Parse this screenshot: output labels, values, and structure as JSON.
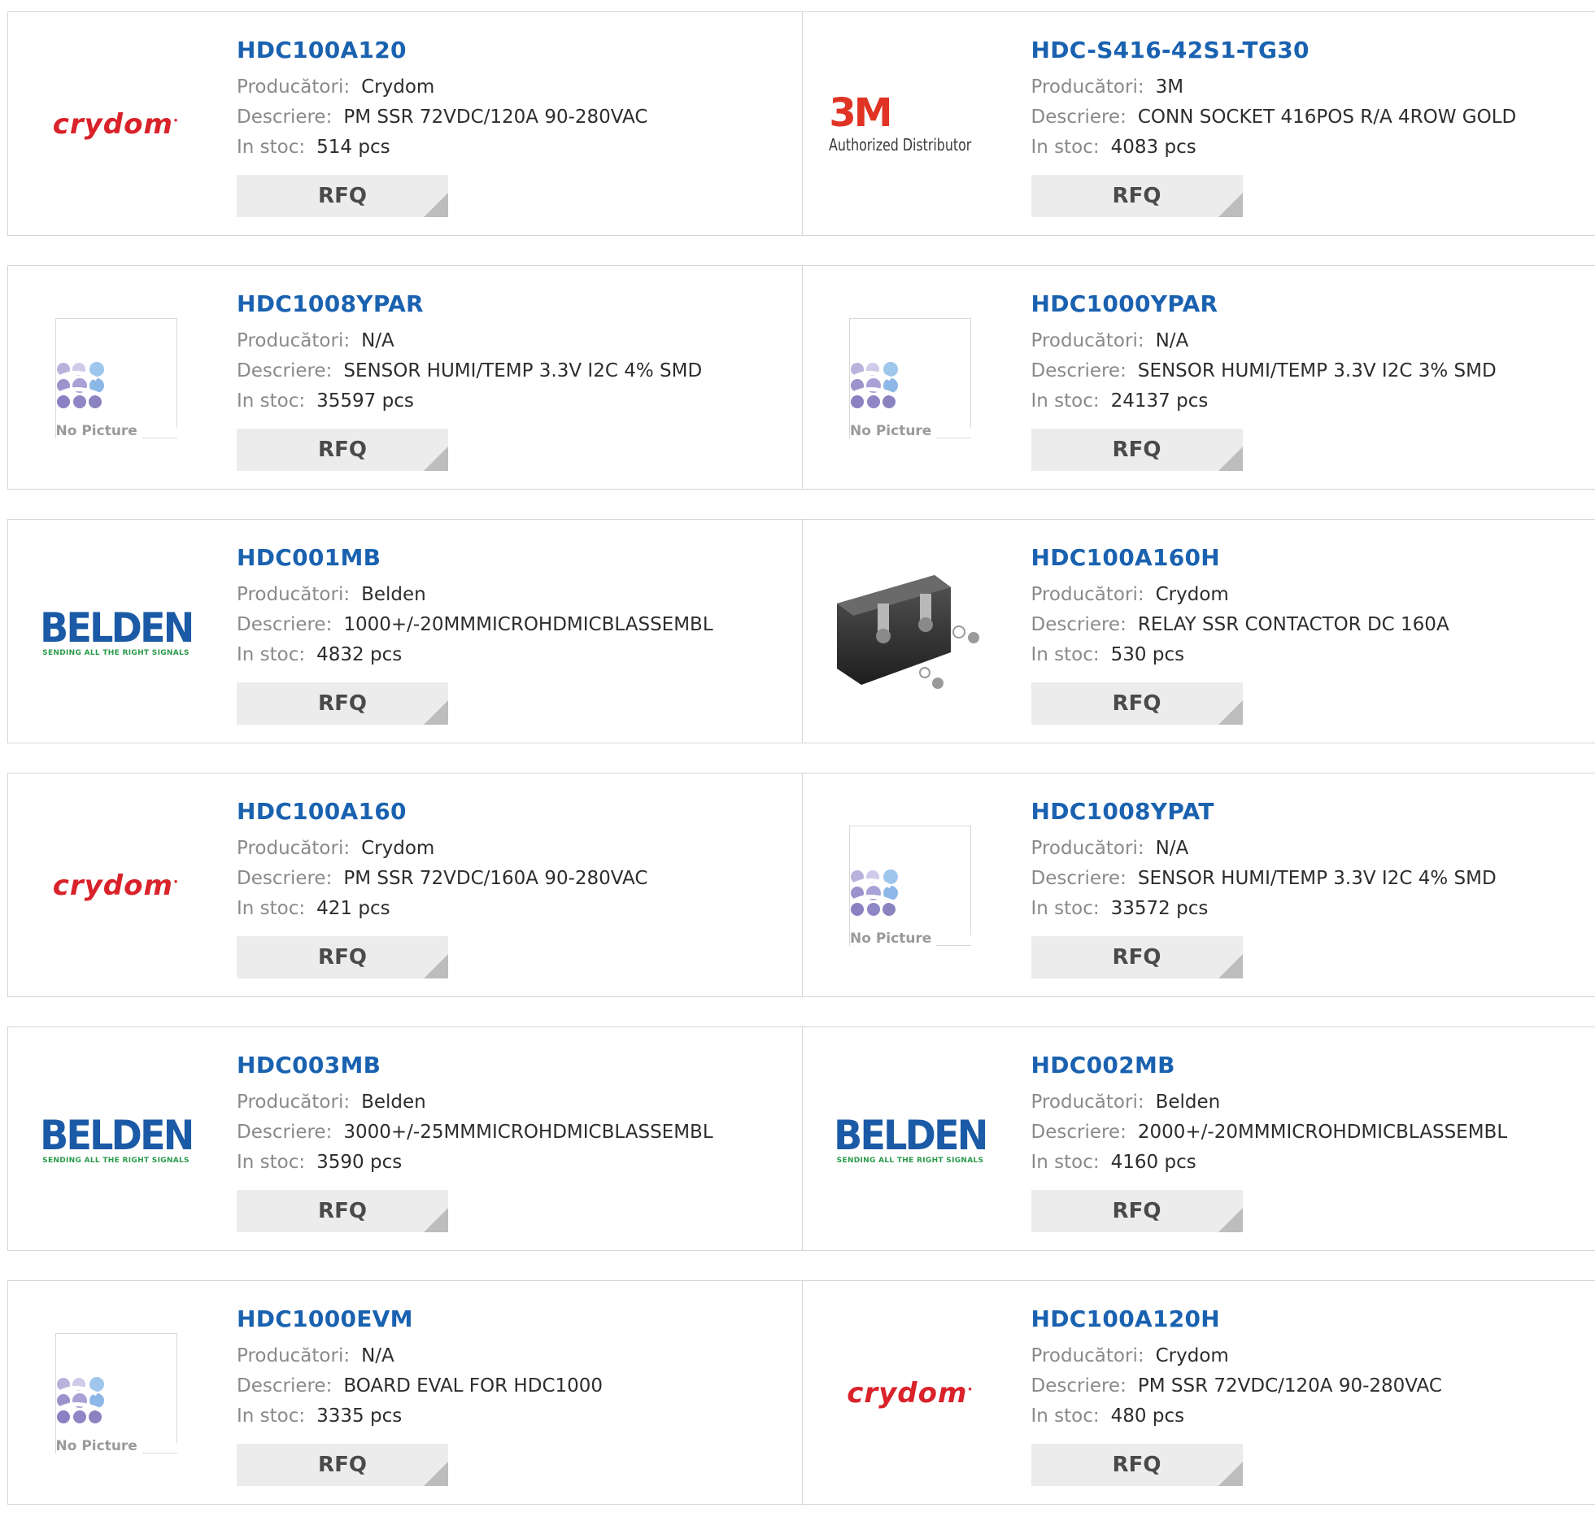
{
  "labels": {
    "manufacturer": "Producători:",
    "description": "Descriere:",
    "stock": "In stoc:",
    "rfq": "RFQ",
    "no_picture": "No Picture"
  },
  "logos": {
    "crydom": "crydom",
    "m3_mark": "3M",
    "m3_sub": "Authorized Distributor",
    "belden_mark": "BELDEN",
    "belden_tag": "SENDING ALL THE RIGHT SIGNALS"
  },
  "colors": {
    "link": "#1a62b0",
    "crydom": "#d9222a",
    "m3": "#e03324",
    "belden": "#1b5aa6",
    "belden_tag": "#2a9a4a",
    "rfq_bg": "#ececec"
  },
  "rows": [
    {
      "left": {
        "part": "HDC100A120",
        "manufacturer": "Crydom",
        "description": "PM SSR 72VDC/120A 90-280VAC",
        "stock": "514 pcs",
        "image": "crydom-logo"
      },
      "right": {
        "part": "HDC-S416-42S1-TG30",
        "manufacturer": "3M",
        "description": "CONN SOCKET 416POS R/A 4ROW GOLD",
        "stock": "4083 pcs",
        "image": "3m-logo"
      }
    },
    {
      "left": {
        "part": "HDC1008YPAR",
        "manufacturer": "N/A",
        "description": "SENSOR HUMI/TEMP 3.3V I2C 4% SMD",
        "stock": "35597 pcs",
        "image": "no-picture"
      },
      "right": {
        "part": "HDC1000YPAR",
        "manufacturer": "N/A",
        "description": "SENSOR HUMI/TEMP 3.3V I2C 3% SMD",
        "stock": "24137 pcs",
        "image": "no-picture"
      }
    },
    {
      "left": {
        "part": "HDC001MB",
        "manufacturer": "Belden",
        "description": "1000+/-20MMMICROHDMICBLASSEMBL",
        "stock": "4832 pcs",
        "image": "belden-logo"
      },
      "right": {
        "part": "HDC100A160H",
        "manufacturer": "Crydom",
        "description": "RELAY SSR CONTACTOR DC 160A",
        "stock": "530 pcs",
        "image": "relay-photo"
      }
    },
    {
      "left": {
        "part": "HDC100A160",
        "manufacturer": "Crydom",
        "description": "PM SSR 72VDC/160A 90-280VAC",
        "stock": "421 pcs",
        "image": "crydom-logo"
      },
      "right": {
        "part": "HDC1008YPAT",
        "manufacturer": "N/A",
        "description": "SENSOR HUMI/TEMP 3.3V I2C 4% SMD",
        "stock": "33572 pcs",
        "image": "no-picture"
      }
    },
    {
      "left": {
        "part": "HDC003MB",
        "manufacturer": "Belden",
        "description": "3000+/-25MMMICROHDMICBLASSEMBL",
        "stock": "3590 pcs",
        "image": "belden-logo"
      },
      "right": {
        "part": "HDC002MB",
        "manufacturer": "Belden",
        "description": "2000+/-20MMMICROHDMICBLASSEMBL",
        "stock": "4160 pcs",
        "image": "belden-logo"
      }
    },
    {
      "left": {
        "part": "HDC1000EVM",
        "manufacturer": "N/A",
        "description": "BOARD EVAL FOR HDC1000",
        "stock": "3335 pcs",
        "image": "no-picture"
      },
      "right": {
        "part": "HDC100A120H",
        "manufacturer": "Crydom",
        "description": "PM SSR 72VDC/120A 90-280VAC",
        "stock": "480 pcs",
        "image": "crydom-logo"
      }
    }
  ]
}
